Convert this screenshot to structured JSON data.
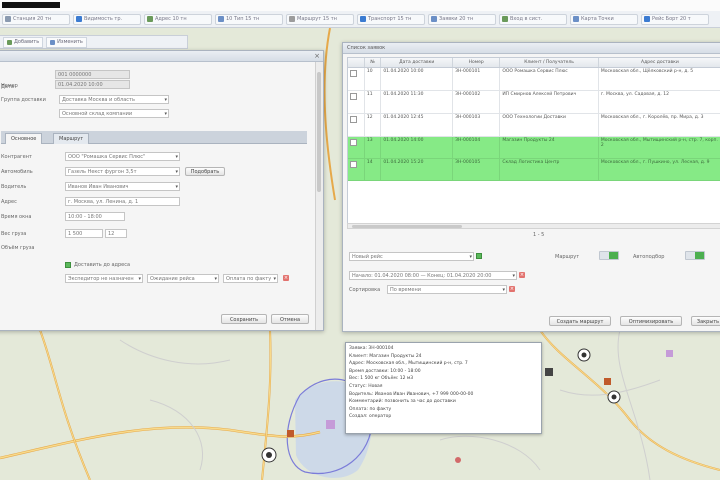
{
  "colors": {
    "map_land": "#dfe6d4",
    "map_water": "#c9d6ea",
    "selected_row": "#86ea86",
    "toggle_on": "#4caf50",
    "danger": "#e2726e",
    "road_major": "#f4d27a",
    "road_outline": "#e6a94a",
    "boundary": "#7b7cd9"
  },
  "bookmarks": [
    {
      "label": "Станция 20 тн",
      "color": "#8a9ab0"
    },
    {
      "label": "Видимость тр.",
      "color": "#3b7bd1"
    },
    {
      "label": "Адрес 10 тн",
      "color": "#6a9a5a"
    },
    {
      "label": "10 Тип 15 тн",
      "color": "#6b8fc6"
    },
    {
      "label": "Маршрут 15 тн",
      "color": "#9c9c9c"
    },
    {
      "label": "Транспорт 15 тн",
      "color": "#3b7bd1"
    },
    {
      "label": "Заявки 20 тн",
      "color": "#6b8fc6"
    },
    {
      "label": "Вход в сист.",
      "color": "#6a9a5a"
    },
    {
      "label": "Карта Точки",
      "color": "#6b8fc6"
    },
    {
      "label": "Рейс Борт 20 т",
      "color": "#3b7bd1"
    }
  ],
  "left_window": {
    "subtoolbar": [
      "Добавить",
      "Изменить"
    ],
    "fields": [
      {
        "label": "Номер",
        "value": "001 0000000"
      },
      {
        "label": "Дата",
        "value": "01.04.2020 10:00"
      },
      {
        "label": "Группа доставки",
        "value": "Доставка Москва и область"
      },
      {
        "label": "",
        "value": "Основной склад компании"
      }
    ],
    "tabs": [
      "Основное",
      "Маршрут"
    ],
    "rows": [
      {
        "label": "Контрагент",
        "value": "ООО \"Ромашка Сервис Плюс\""
      },
      {
        "label": "Автомобиль",
        "value": "Газель Некст фургон 3,5т"
      },
      {
        "label": "Водитель",
        "value": "Иванов Иван Иванович"
      },
      {
        "label": "Адрес",
        "value": "г. Москва, ул. Ленина, д. 1"
      },
      {
        "label": "Время окна",
        "value": "10:00 - 18:00"
      },
      {
        "label": "Вес груза",
        "value": "1 500"
      },
      {
        "label": "Объём груза",
        "value": "12"
      }
    ],
    "secondary_button": "Подобрать",
    "checkbox_label": "Доставить до адреса",
    "bottom_selects": [
      "Экспедитор не назначен",
      "Ожидание рейса",
      "Оплата по факту"
    ],
    "buttons": {
      "save": "Сохранить",
      "cancel": "Отмена"
    }
  },
  "right_window": {
    "title": "Список заявок",
    "columns": [
      "",
      "№",
      "Дата доставки",
      "Номер",
      "Клиент / Получатель",
      "Адрес доставки"
    ],
    "rows": [
      {
        "num": "10",
        "date": "01.04.2020 10:00",
        "code": "ЗН-000101",
        "client": "ООО Ромашка Сервис Плюс",
        "addr": "Московская обл., Щёлковский р-н, д. 5",
        "highlight": false
      },
      {
        "num": "11",
        "date": "01.04.2020 11:30",
        "code": "ЗН-000102",
        "client": "ИП Смирнов Алексей Петрович",
        "addr": "г. Москва, ул. Садовая, д. 12",
        "highlight": false
      },
      {
        "num": "12",
        "date": "01.04.2020 12:45",
        "code": "ЗН-000103",
        "client": "ООО Технологии Доставки",
        "addr": "Московская обл., г. Королёв, пр. Мира, д. 3",
        "highlight": false
      },
      {
        "num": "13",
        "date": "01.04.2020 14:00",
        "code": "ЗН-000104",
        "client": "Магазин Продукты 24",
        "addr": "Московская обл., Мытищинский р-н, стр. 7, корп. 2",
        "highlight": true
      },
      {
        "num": "14",
        "date": "01.04.2020 15:20",
        "code": "ЗН-000105",
        "client": "Склад Логистика Центр",
        "addr": "Московская обл., г. Пушкино, ул. Лесная, д. 9",
        "highlight": true
      }
    ],
    "pager": "1 - 5",
    "route_select": "Новый рейс",
    "toggle1_label": "Маршрут",
    "toggle2_label": "Автоподбор",
    "filter1": "Начало: 01.04.2020 08:00 — Конец: 01.04.2020 20:00",
    "filter2_label": "Сортировка",
    "filter2_value": "По времени",
    "buttons": [
      "Создать маршрут",
      "Оптимизировать",
      "Закрыть"
    ]
  },
  "popup": {
    "lines": [
      "Заявка: ЗН-000104",
      "Клиент: Магазин Продукты 24",
      "Адрес: Московская обл., Мытищинский р-н, стр. 7",
      "Время доставки: 10:00 - 18:00",
      "Вес: 1 500 кг   Объём: 12 м3",
      "Статус: Новая",
      "Водитель: Иванов Иван Иванович, +7 999 000-00-00",
      "Комментарий: позвонить за час до доставки",
      "Оплата: по факту",
      "Создал: оператор"
    ]
  }
}
